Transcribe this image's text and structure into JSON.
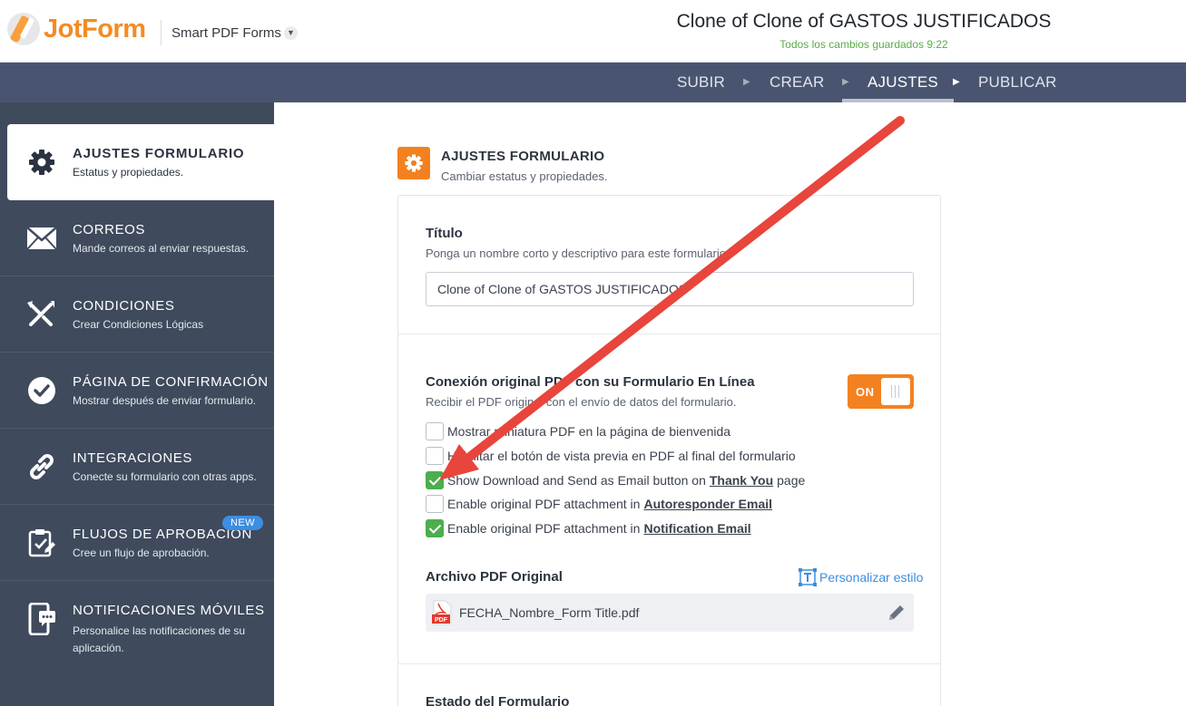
{
  "header": {
    "logo_text": "JotForm",
    "product": "Smart PDF Forms",
    "form_title": "Clone of Clone of GASTOS JUSTIFICADOS",
    "saved_status": "Todos los cambios guardados 9:22"
  },
  "nav": {
    "items": [
      {
        "label": "SUBIR"
      },
      {
        "label": "CREAR"
      },
      {
        "label": "AJUSTES",
        "active": true
      },
      {
        "label": "PUBLICAR"
      }
    ]
  },
  "sidebar": {
    "items": [
      {
        "title": "AJUSTES FORMULARIO",
        "subtitle": "Estatus y propiedades.",
        "icon": "gear-icon",
        "active": true
      },
      {
        "title": "CORREOS",
        "subtitle": "Mande correos al enviar respuestas.",
        "icon": "envelope-icon"
      },
      {
        "title": "CONDICIONES",
        "subtitle": "Crear Condiciones Lógicas",
        "icon": "conditions-icon"
      },
      {
        "title": "PÁGINA DE CONFIRMACIÓN",
        "subtitle": "Mostrar después de enviar formulario.",
        "icon": "check-circle-icon"
      },
      {
        "title": "INTEGRACIONES",
        "subtitle": "Conecte su formulario con otras apps.",
        "icon": "link-icon"
      },
      {
        "title": "FLUJOS DE APROBACIÓN",
        "subtitle": "Cree un flujo de aprobación.",
        "icon": "approval-icon",
        "badge": "NEW"
      },
      {
        "title": "NOTIFICACIONES MÓVILES",
        "subtitle": "Personalice las notificaciones de su aplicación.",
        "icon": "mobile-notification-icon"
      }
    ]
  },
  "main": {
    "section_title": "AJUSTES FORMULARIO",
    "section_subtitle": "Cambiar estatus y propiedades.",
    "title_field": {
      "label": "Título",
      "help": "Ponga un nombre corto y descriptivo para este formulario.",
      "value": "Clone of Clone of GASTOS JUSTIFICADOS"
    },
    "pdf_connection": {
      "label": "Conexión original PDF con su Formulario En Línea",
      "help": "Recibir el PDF original con el envío de datos del formulario.",
      "toggle_label": "ON",
      "toggle_on": true
    },
    "options": [
      {
        "text": "Mostrar miniatura PDF en la página de bienvenida",
        "checked": false
      },
      {
        "text": "Habilitar el botón de vista previa en PDF al final del formulario",
        "checked": false
      },
      {
        "pre": "Show Download and Send as Email button on",
        "link": "Thank You",
        "post": "page",
        "checked": true
      },
      {
        "pre": "Enable original PDF attachment in",
        "link": "Autoresponder Email",
        "post": "",
        "checked": false
      },
      {
        "pre": "Enable original PDF attachment in",
        "link": "Notification Email",
        "post": "",
        "checked": true
      }
    ],
    "original_pdf": {
      "label": "Archivo PDF Original",
      "customize_label": "Personalizar estilo",
      "file_name": "FECHA_Nombre_Form Title.pdf",
      "file_icon_text": "PDF"
    },
    "form_status_label": "Estado del Formulario"
  },
  "colors": {
    "brand_orange": "#f4811f",
    "navbar": "#495570",
    "sidebar": "#3f4a5c",
    "check_green": "#4cae4c",
    "saved_green": "#5aab46",
    "link_blue": "#3d8de0",
    "annotation_arrow": "#e8453c"
  }
}
